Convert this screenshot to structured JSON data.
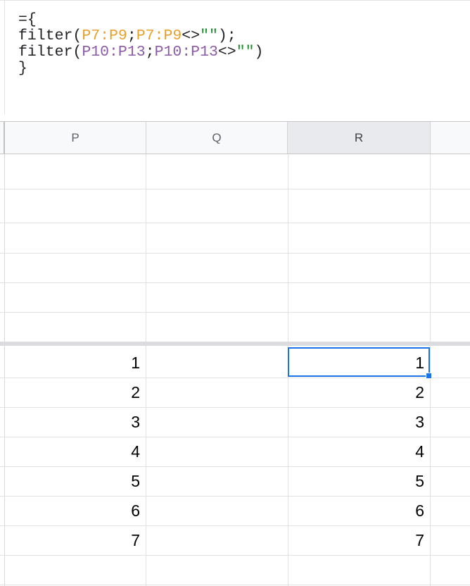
{
  "formula": {
    "line1": "={",
    "line2": {
      "fn": "filter(",
      "ref1": "P7:P9",
      "sep": ";",
      "ref2": "P7:P9",
      "op": "<>",
      "str": "\"\"",
      "end": ");"
    },
    "line3": {
      "fn": "filter(",
      "ref1": "P10:P13",
      "sep": ";",
      "ref2": "P10:P13",
      "op": "<>",
      "str": "\"\"",
      "end": ")"
    },
    "line4": "}"
  },
  "columns": [
    {
      "label": "P",
      "selected": false
    },
    {
      "label": "Q",
      "selected": false
    },
    {
      "label": "R",
      "selected": true
    }
  ],
  "data_rows": {
    "P": [
      "1",
      "2",
      "3",
      "4",
      "5",
      "6",
      "7"
    ],
    "R": [
      "1",
      "2",
      "3",
      "4",
      "5",
      "6",
      "7"
    ]
  },
  "colors": {
    "range_ref_1": "#e8a12b",
    "range_ref_2": "#8e5ba8",
    "string_literal": "#1e8a2e",
    "selection": "#1a73e8"
  }
}
